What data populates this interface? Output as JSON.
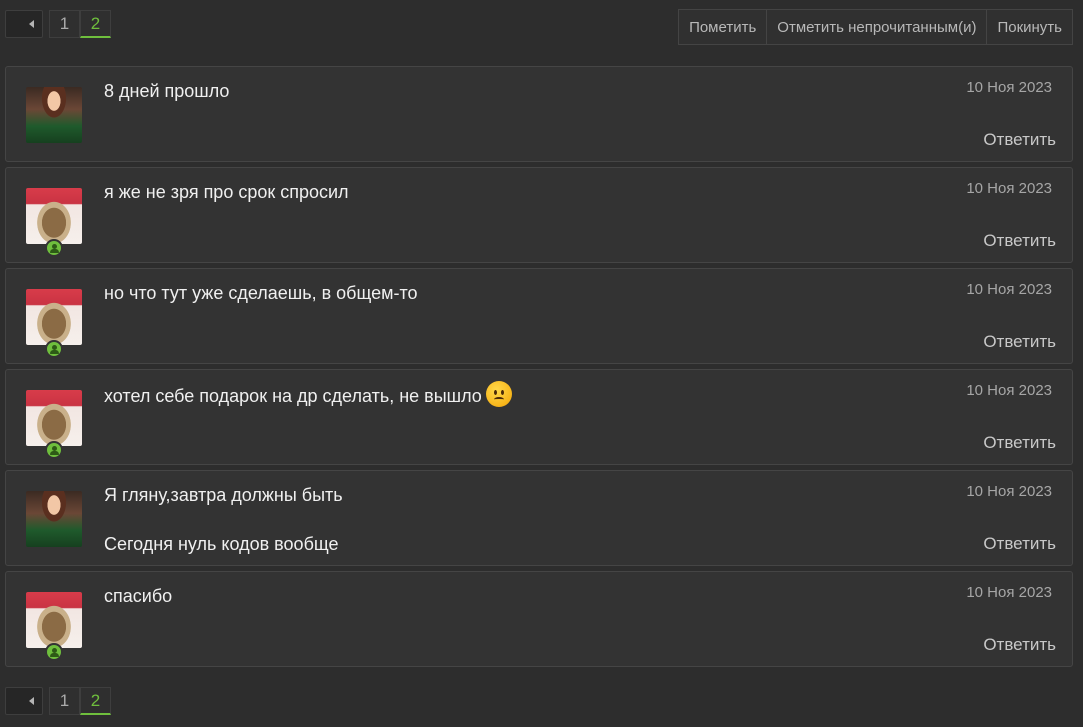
{
  "pagination": {
    "prev_icon": "caret-left-icon",
    "pages": [
      "1",
      "2"
    ],
    "active_page": "2"
  },
  "actions": {
    "mark": "Пометить",
    "mark_unread": "Отметить непрочитанным(и)",
    "leave": "Покинуть"
  },
  "messages": [
    {
      "avatar": "girl-avatar",
      "online": false,
      "lines": [
        "8 дней прошло"
      ],
      "date": "10 Ноя 2023",
      "reply": "Ответить"
    },
    {
      "avatar": "cat-avatar",
      "online": true,
      "lines": [
        "я же не зря про срок спросил"
      ],
      "date": "10 Ноя 2023",
      "reply": "Ответить"
    },
    {
      "avatar": "cat-avatar",
      "online": true,
      "lines": [
        "но что тут уже сделаешь, в общем-то"
      ],
      "date": "10 Ноя 2023",
      "reply": "Ответить"
    },
    {
      "avatar": "cat-avatar",
      "online": true,
      "lines": [
        "хотел себе подарок на др сделать, не вышло"
      ],
      "emoji": "sad-face-icon",
      "date": "10 Ноя 2023",
      "reply": "Ответить"
    },
    {
      "avatar": "girl-avatar",
      "online": false,
      "lines": [
        "Я гляну,завтра должны быть",
        "Сегодня нуль кодов вообще"
      ],
      "date": "10 Ноя 2023",
      "reply": "Ответить"
    },
    {
      "avatar": "cat-avatar",
      "online": true,
      "lines": [
        "спасибо"
      ],
      "date": "10 Ноя 2023",
      "reply": "Ответить"
    }
  ],
  "colors": {
    "background": "#2d2d2d",
    "card": "#333333",
    "accent_green": "#6fbf3d",
    "muted_text": "#a6a6a6"
  }
}
